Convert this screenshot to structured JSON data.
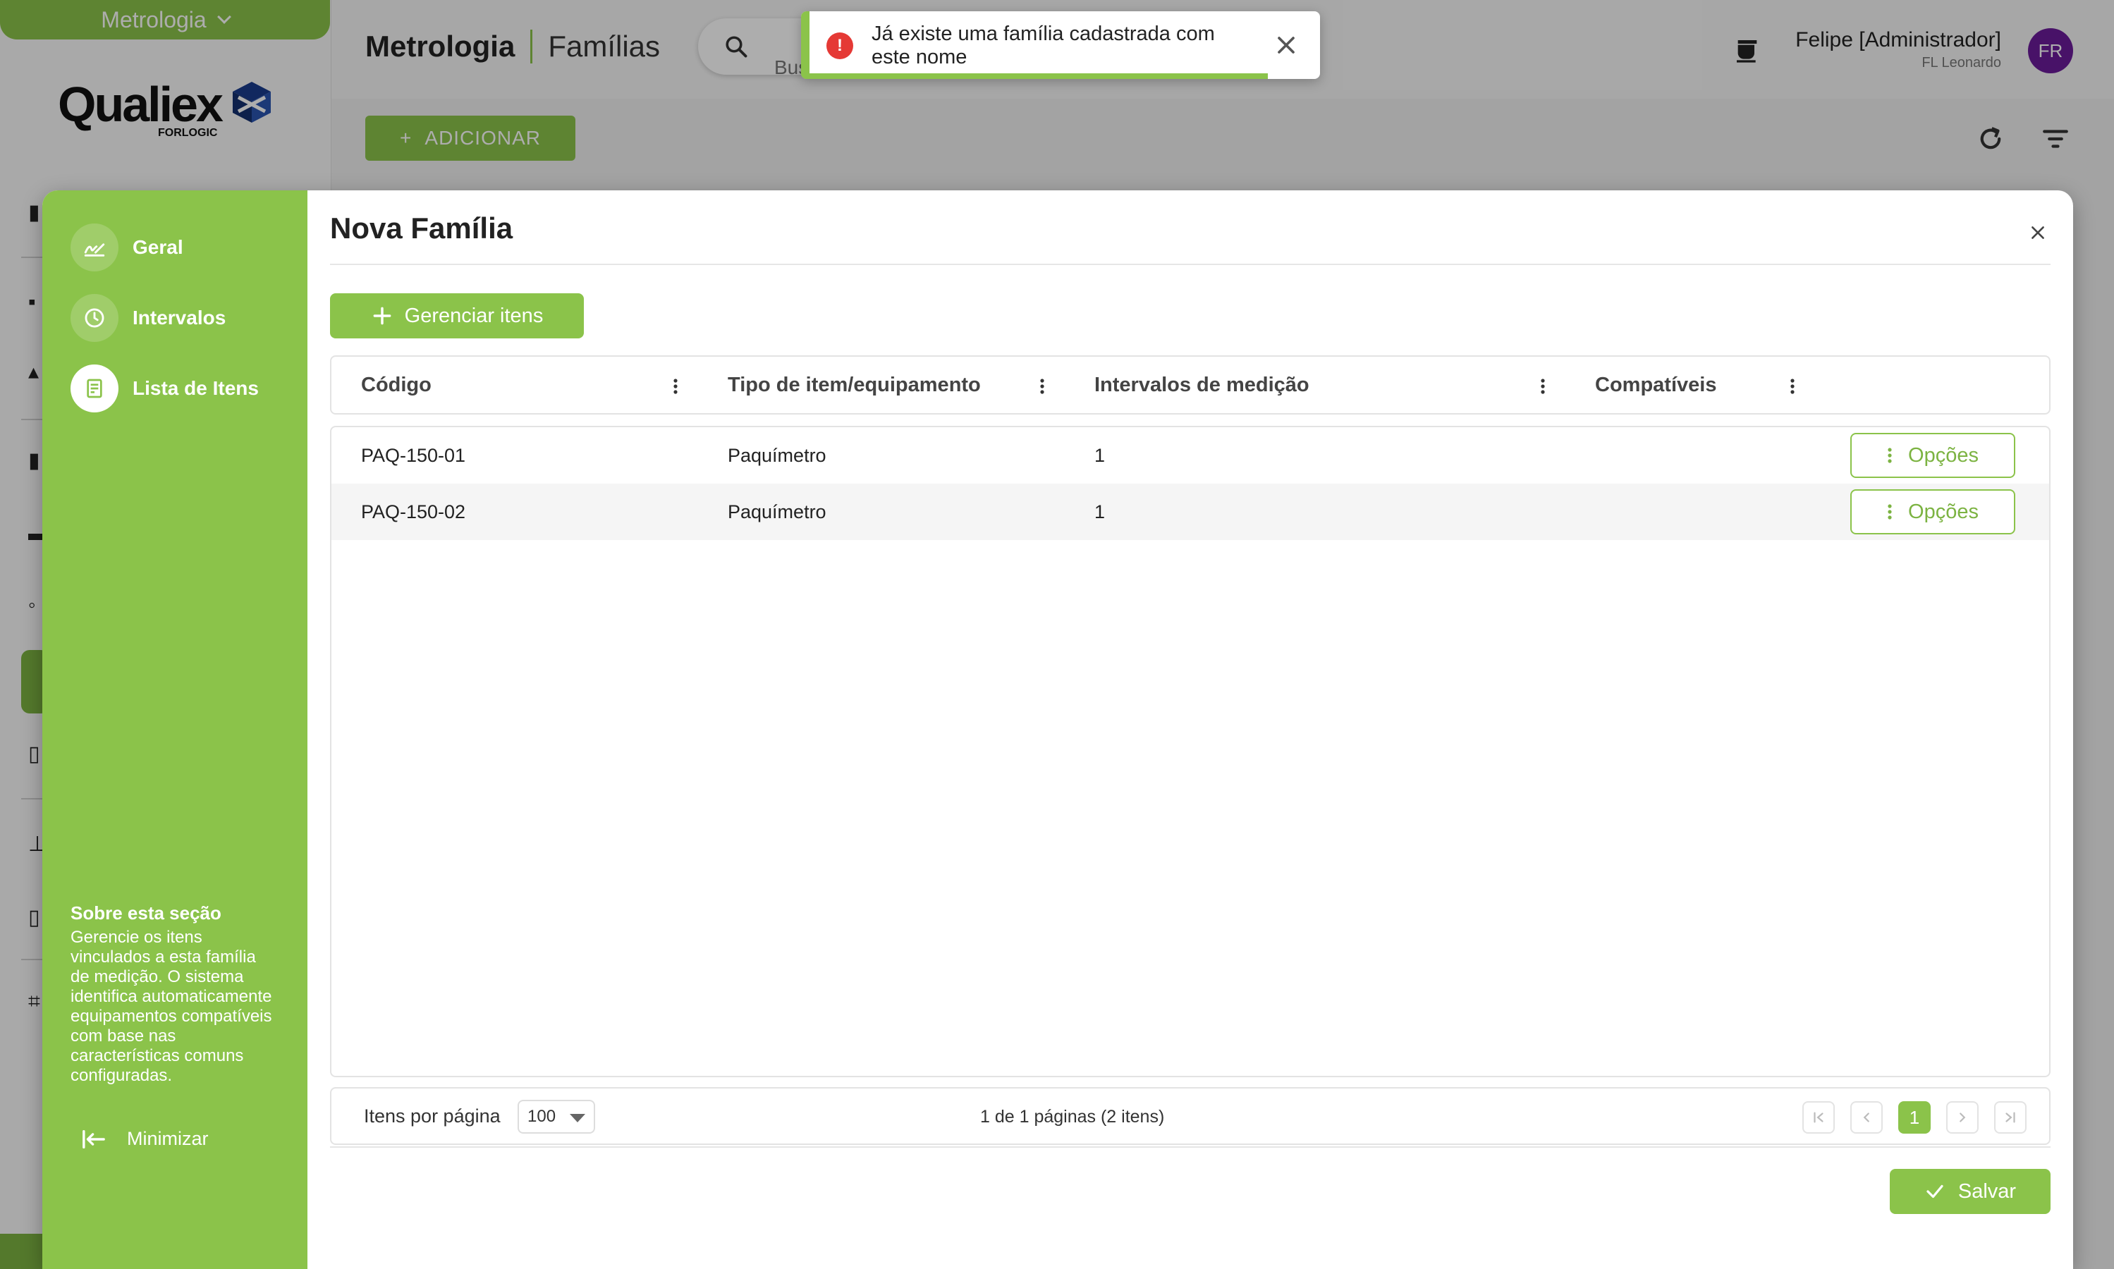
{
  "app": {
    "module": "Metrologia",
    "logo_text": "Qualiex",
    "logo_sub": "FORLOGIC",
    "breadcrumb": [
      "Metrologia",
      "Famílias"
    ],
    "search_placeholder": "Busc",
    "add_label": "ADICIONAR",
    "user": {
      "name": "Felipe [Administrador]",
      "org": "FL Leonardo",
      "initials": "FR"
    },
    "colors": {
      "accent": "#8bc34a",
      "avatar": "#6a1b9a",
      "error": "#e53935"
    }
  },
  "toast": {
    "message": "Já existe uma família cadastrada com este nome",
    "progress": 0.9
  },
  "modal": {
    "title": "Nova Família",
    "nav": [
      {
        "label": "Geral",
        "icon": "signature-icon"
      },
      {
        "label": "Intervalos",
        "icon": "clock-icon"
      },
      {
        "label": "Lista de Itens",
        "icon": "list-doc-icon",
        "active": true
      }
    ],
    "about_title": "Sobre esta seção",
    "about_text": "Gerencie os itens vinculados a esta família de medição. O sistema identifica automaticamente equipamentos compatíveis com base nas características comuns configuradas.",
    "minimize_label": "Minimizar",
    "manage_label": "Gerenciar itens",
    "columns": [
      "Código",
      "Tipo de item/equipamento",
      "Intervalos de medição",
      "Compatíveis"
    ],
    "rows": [
      {
        "code": "PAQ-150-01",
        "type": "Paquímetro",
        "intervals": "1",
        "compatible": "",
        "action": "Opções"
      },
      {
        "code": "PAQ-150-02",
        "type": "Paquímetro",
        "intervals": "1",
        "compatible": "",
        "action": "Opções"
      }
    ],
    "pager": {
      "per_page_label": "Itens por página",
      "per_page_value": "100",
      "info": "1 de 1 páginas (2 itens)",
      "current_page": "1"
    },
    "save_label": "Salvar"
  }
}
